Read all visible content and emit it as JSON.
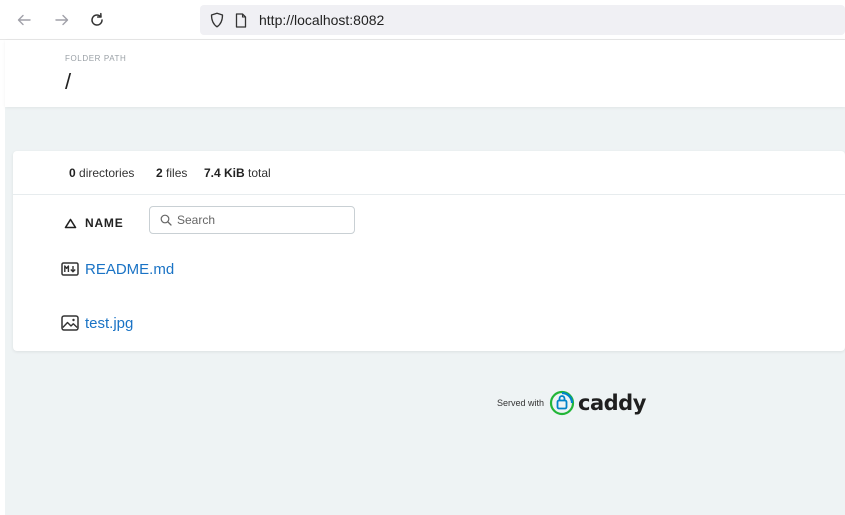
{
  "browser": {
    "url": "http://localhost:8082"
  },
  "header": {
    "folder_caption": "FOLDER PATH",
    "folder_path": "/"
  },
  "summary": {
    "directories_count": "0",
    "directories_label": "directories",
    "files_count": "2",
    "files_label": "files",
    "total_size": "7.4 KiB",
    "total_label": "total"
  },
  "listing": {
    "name_column": "NAME",
    "search_placeholder": "Search",
    "files": [
      {
        "name": "README.md",
        "icon": "markdown-file-icon"
      },
      {
        "name": "test.jpg",
        "icon": "image-file-icon"
      }
    ]
  },
  "footer": {
    "served_with": "Served with",
    "brand": "caddy"
  },
  "colors": {
    "link": "#1a73c5",
    "page_bg": "#eef3f4",
    "caddy_green": "#22b638",
    "caddy_blue": "#0083c8"
  }
}
